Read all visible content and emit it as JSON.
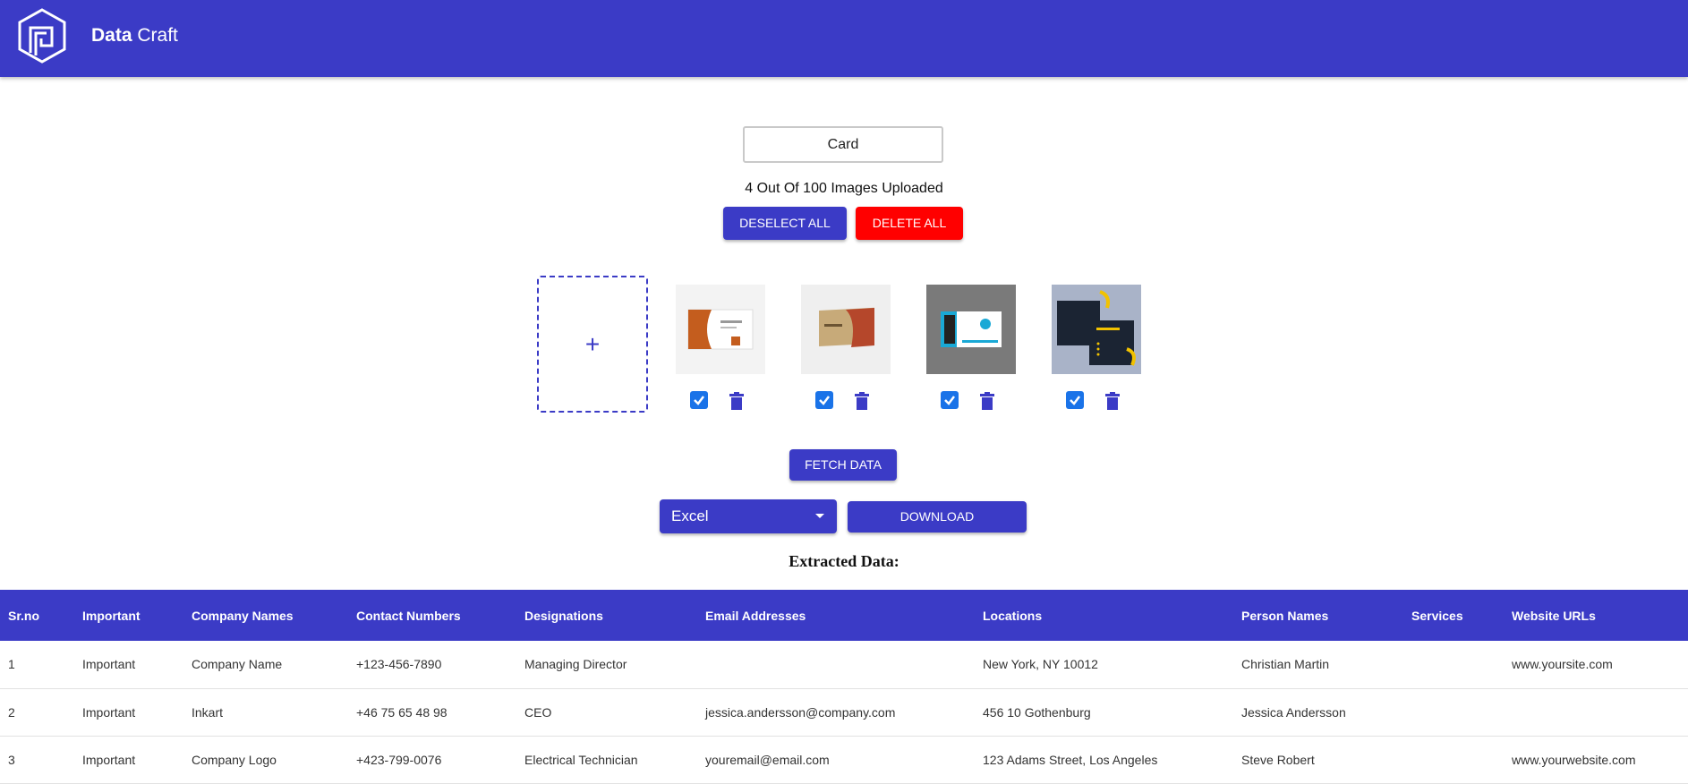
{
  "app": {
    "brand_bold": "Data",
    "brand_rest": " Craft"
  },
  "card_field": {
    "value": "Card"
  },
  "upload_status": "4 Out Of 100 Images Uploaded",
  "buttons": {
    "deselect_all": "Deselect All",
    "delete_all": "Delete All",
    "fetch_data": "Fetch Data",
    "download": "Download"
  },
  "add_tile": {
    "symbol": "+"
  },
  "format_select": {
    "value": "Excel"
  },
  "extracted_title": "Extracted Data:",
  "colors": {
    "primary": "#3b3bc6",
    "danger": "#ff0000",
    "checkbox": "#1a73e8"
  },
  "table": {
    "headers": [
      "Sr.no",
      "Important",
      "Company Names",
      "Contact Numbers",
      "Designations",
      "Email Addresses",
      "Locations",
      "Person Names",
      "Services",
      "Website URLs"
    ],
    "rows": [
      [
        "1",
        "Important",
        "Company Name",
        "+123-456-7890",
        "Managing Director",
        "",
        "New York, NY 10012",
        "Christian Martin",
        "",
        "www.yoursite.com"
      ],
      [
        "2",
        "Important",
        "Inkart",
        "+46 75 65 48 98",
        "CEO",
        "jessica.andersson@company.com",
        "456 10 Gothenburg",
        "Jessica Andersson",
        "",
        ""
      ],
      [
        "3",
        "Important",
        "Company Logo",
        "+423-799-0076",
        "Electrical Technician",
        "youremail@email.com",
        "123 Adams Street, Los Angeles",
        "Steve Robert",
        "",
        "www.yourwebsite.com"
      ]
    ]
  }
}
